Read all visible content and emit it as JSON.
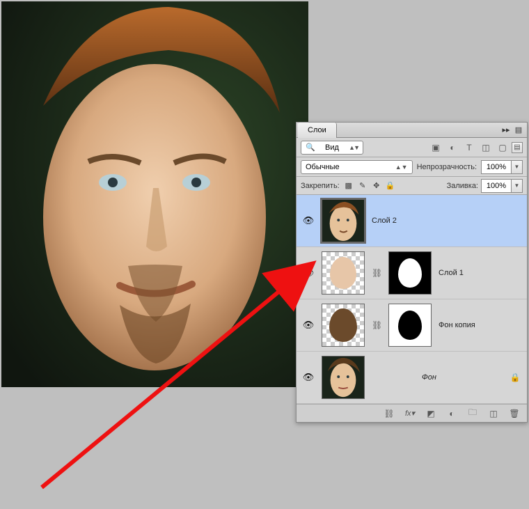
{
  "panel": {
    "tab_label": "Слои",
    "search_label": "Вид",
    "blend_mode": "Обычные",
    "opacity_label": "Непрозрачность:",
    "opacity_value": "100%",
    "lock_label": "Закрепить:",
    "fill_label": "Заливка:",
    "fill_value": "100%"
  },
  "layers": [
    {
      "name": "Слой 2",
      "visible": true,
      "selected": true,
      "mask": null,
      "locked": false,
      "italic": false
    },
    {
      "name": "Слой 1",
      "visible": true,
      "selected": false,
      "mask": "black-white-oval",
      "locked": false,
      "italic": false
    },
    {
      "name": "Фон копия",
      "visible": true,
      "selected": false,
      "mask": "white-black-oval",
      "locked": false,
      "italic": false
    },
    {
      "name": "Фон",
      "visible": true,
      "selected": false,
      "mask": null,
      "locked": true,
      "italic": true
    }
  ],
  "icons": {
    "filter_row": [
      "image-icon",
      "adjust-icon",
      "type-icon",
      "shape-icon",
      "smart-icon"
    ],
    "lock_row": [
      "lock-transparency-icon",
      "lock-brush-icon",
      "lock-move-icon",
      "lock-all-icon"
    ],
    "bottom": [
      "link-icon",
      "fx-icon",
      "mask-icon",
      "adjustment-icon",
      "group-icon",
      "new-icon",
      "trash-icon"
    ]
  }
}
